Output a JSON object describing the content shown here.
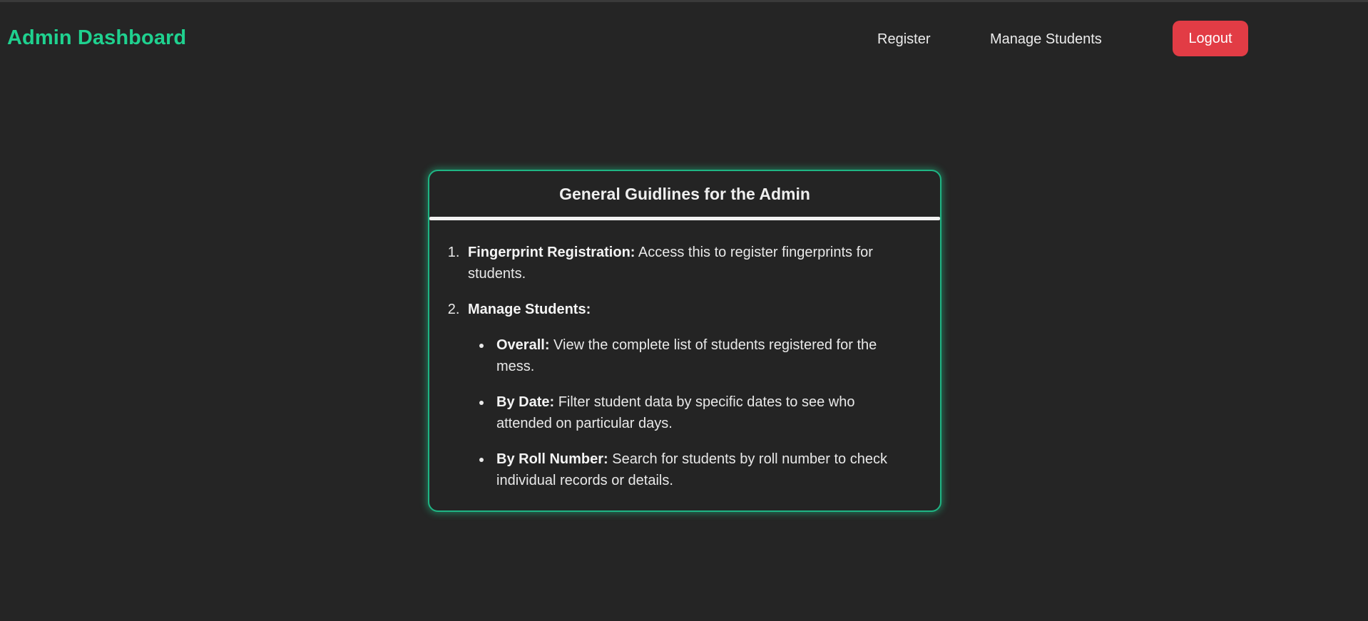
{
  "navbar": {
    "brand": "Admin Dashboard",
    "links": {
      "register": "Register",
      "manage_students": "Manage Students"
    },
    "logout_label": "Logout"
  },
  "colors": {
    "background": "#252525",
    "accent": "#1fd18f",
    "logout": "#e23c45",
    "text": "#e9e9e9"
  },
  "guidelines": {
    "title": "General Guidlines for the Admin",
    "items": [
      {
        "heading": "Fingerprint Registration:",
        "text": " Access this to register fingerprints for students."
      },
      {
        "heading": "Manage Students:",
        "text": "",
        "subitems": [
          {
            "heading": "Overall:",
            "text": " View the complete list of students registered for the mess."
          },
          {
            "heading": "By Date:",
            "text": " Filter student data by specific dates to see who attended on particular days."
          },
          {
            "heading": "By Roll Number:",
            "text": " Search for students by roll number to check individual records or details."
          }
        ]
      }
    ]
  }
}
